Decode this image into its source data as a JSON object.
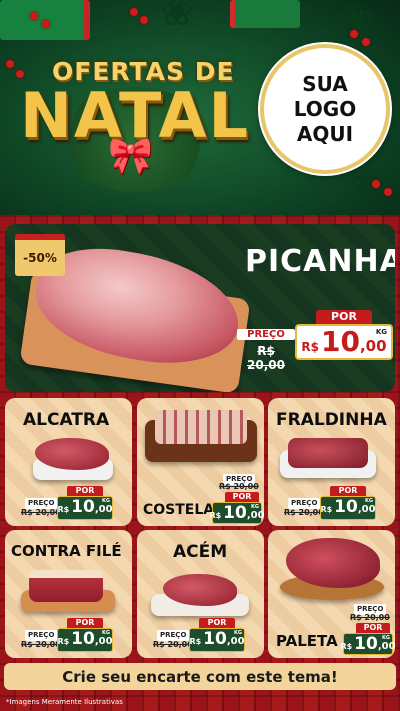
{
  "header": {
    "title_top": "OFERTAS DE",
    "title_main": "NATAL",
    "logo_lines": [
      "SUA",
      "LOGO",
      "AQUI"
    ]
  },
  "featured": {
    "discount_badge": "-50%",
    "name": "PICANHA",
    "preco_label": "PREÇO",
    "old_price": "R$ 20,00",
    "por_label": "POR",
    "currency": "R$",
    "price_int": "10",
    "price_dec": ",00",
    "unit": "KG"
  },
  "products": [
    {
      "name": "ALCATRA",
      "preco_label": "PREÇO",
      "old_price": "R$ 20,00",
      "por_label": "POR",
      "currency": "R$",
      "price_int": "10",
      "price_dec": ",00",
      "unit": "KG"
    },
    {
      "name": "COSTELA",
      "preco_label": "PREÇO",
      "old_price": "R$ 20,00",
      "por_label": "POR",
      "currency": "R$",
      "price_int": "10",
      "price_dec": ",00",
      "unit": "KG"
    },
    {
      "name": "FRALDINHA",
      "preco_label": "PREÇO",
      "old_price": "R$ 20,00",
      "por_label": "POR",
      "currency": "R$",
      "price_int": "10",
      "price_dec": ",00",
      "unit": "KG"
    },
    {
      "name": "CONTRA FILÉ",
      "preco_label": "PREÇO",
      "old_price": "R$ 20,00",
      "por_label": "POR",
      "currency": "R$",
      "price_int": "10",
      "price_dec": ",00",
      "unit": "KG"
    },
    {
      "name": "ACÉM",
      "preco_label": "PREÇO",
      "old_price": "R$ 20,00",
      "por_label": "POR",
      "currency": "R$",
      "price_int": "10",
      "price_dec": ",00",
      "unit": "KG"
    },
    {
      "name": "PALETA",
      "preco_label": "PREÇO",
      "old_price": "R$ 20,00",
      "por_label": "POR",
      "currency": "R$",
      "price_int": "10",
      "price_dec": ",00",
      "unit": "KG"
    }
  ],
  "cta": "Crie seu encarte com este tema!",
  "footnote": "*Imagens Meramente Ilustrativas",
  "colors": {
    "accent_red": "#c41c1c",
    "gold": "#e5b73b",
    "dark_green": "#1d4d2a",
    "card_beige": "#f3d8b0"
  }
}
